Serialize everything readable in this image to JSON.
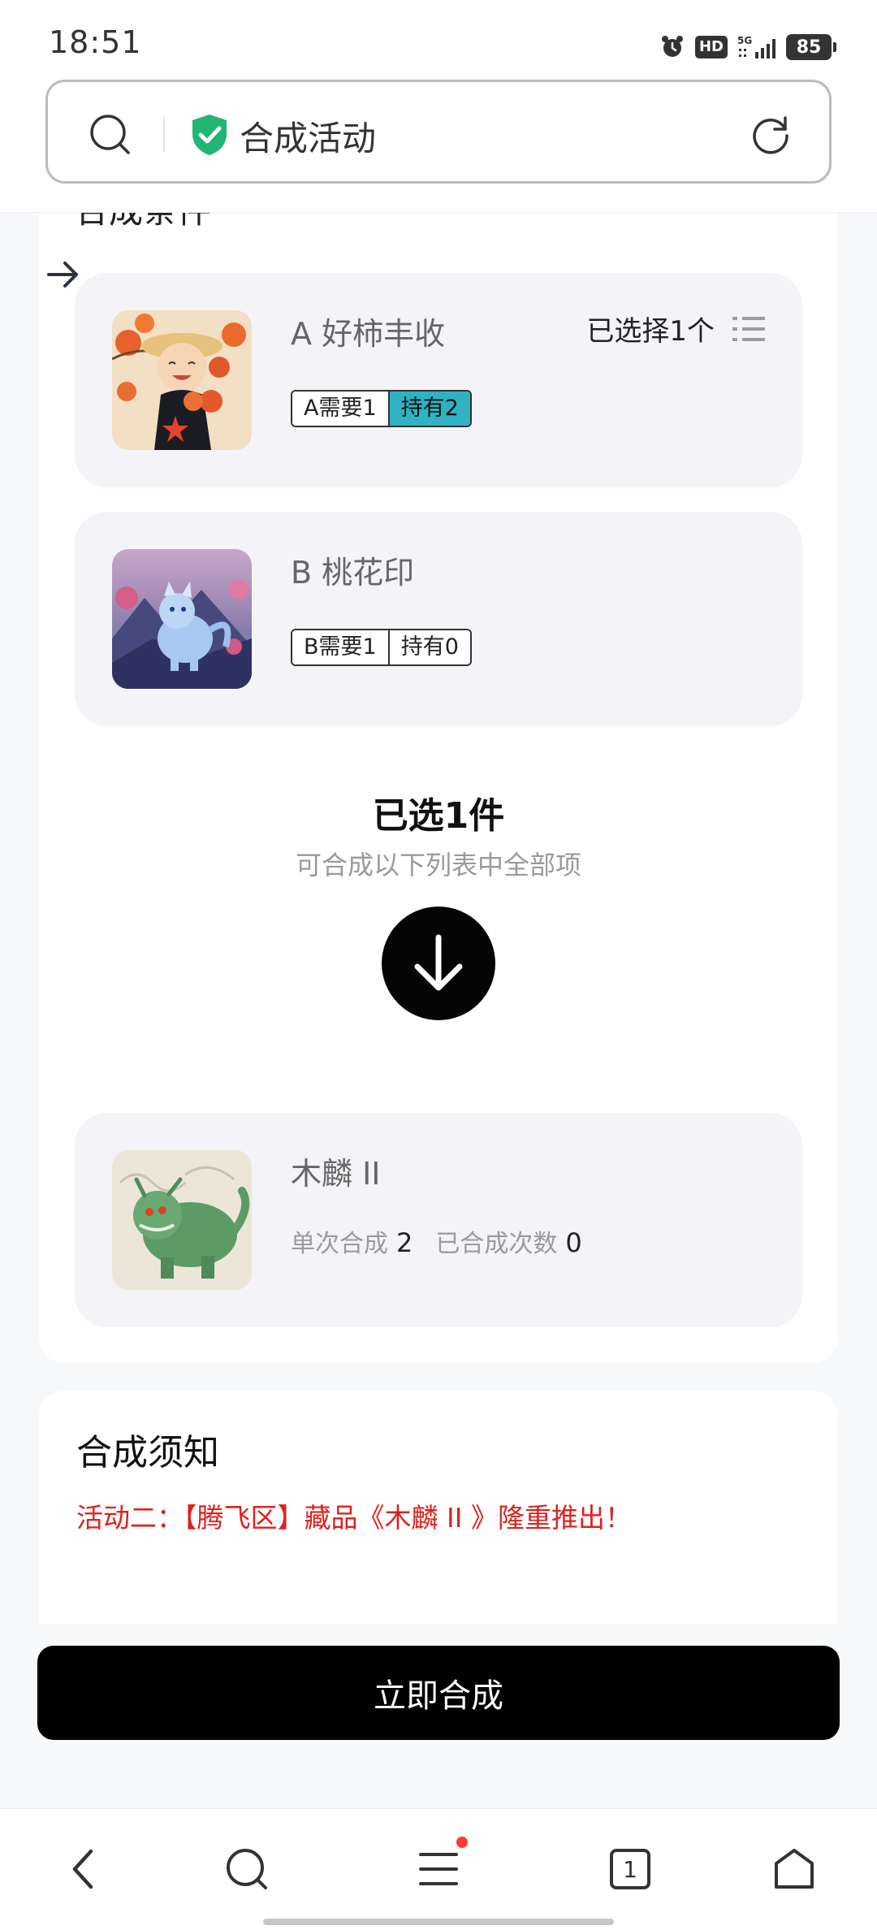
{
  "status_bar": {
    "time": "18:51",
    "hd_label": "HD",
    "network_label": "5G",
    "battery": "85"
  },
  "address_bar": {
    "title": "合成活动",
    "secure_icon": "shield-check-icon",
    "accent": "#22b573"
  },
  "section": {
    "heading_partial": "合成条件"
  },
  "items": [
    {
      "name": "A 好柿丰收",
      "need": "A需要1",
      "owned": "持有2",
      "owned_highlight": true,
      "selected": "已选择1个"
    },
    {
      "name": "B 桃花印",
      "need": "B需要1",
      "owned": "持有0",
      "owned_highlight": false
    }
  ],
  "selection": {
    "count": "已选1件",
    "subtitle": "可合成以下列表中全部项"
  },
  "result": {
    "name": "木麟 II",
    "single_label": "单次合成",
    "single_value": "2",
    "done_label": "已合成次数",
    "done_value": "0"
  },
  "notice": {
    "title": "合成须知",
    "text": "活动二：【腾飞区】藏品《木麟 II 》隆重推出！"
  },
  "actions": {
    "merge": "立即合成"
  },
  "nav": {
    "tab_count": "1"
  },
  "colors": {
    "highlight_tag": "#2fb3c2",
    "notice_text": "#e0201c",
    "button": "#000000"
  }
}
